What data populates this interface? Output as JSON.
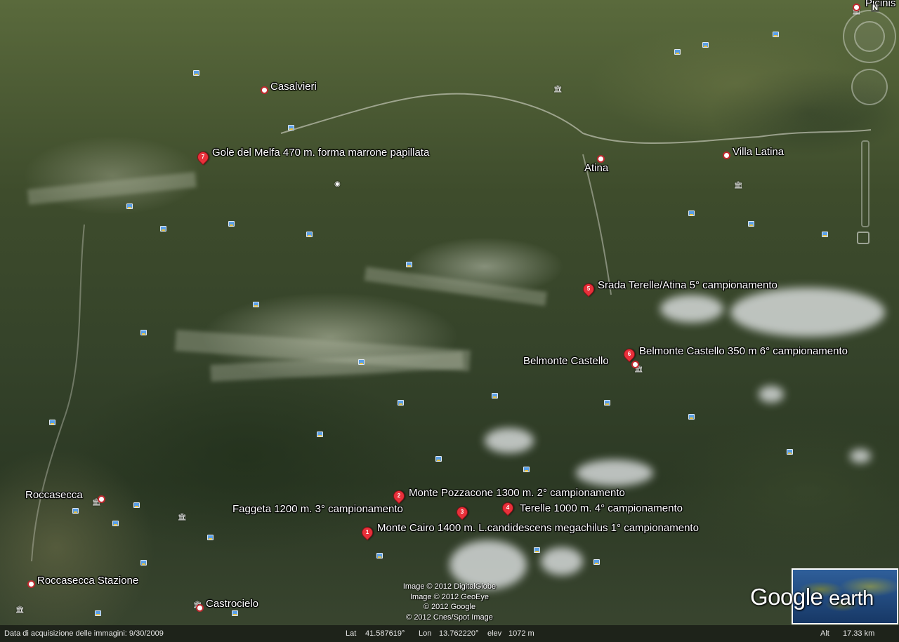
{
  "placemarks": [
    {
      "number": "1",
      "label": "Monte Cairo 1400 m. L.candidescens megachilus 1° campionamento"
    },
    {
      "number": "2",
      "label": "Monte Pozzacone 1300 m. 2° campionamento"
    },
    {
      "number": "3",
      "label": "Faggeta 1200 m. 3° campionamento"
    },
    {
      "number": "4",
      "label": "Terelle 1000 m. 4° campionamento"
    },
    {
      "number": "5",
      "label": "Srada Terelle/Atina 5° campionamento"
    },
    {
      "number": "6",
      "label": "Belmonte Castello 350 m 6° campionamento"
    },
    {
      "number": "7",
      "label": "Gole del Melfa 470 m. forma marrone papillata"
    }
  ],
  "places": {
    "picinisco": "Picinis",
    "casalvieri": "Casalvieri",
    "atina": "Atina",
    "villa_latina": "Villa Latina",
    "belmonte_castello": "Belmonte Castello",
    "roccasecca": "Roccasecca",
    "roccasecca_stazione": "Roccasecca Stazione",
    "castrocielo": "Castrocielo"
  },
  "navigation": {
    "north": "N"
  },
  "copyright": [
    "Image © 2012 DigitalGlobe",
    "Image © 2012 GeoEye",
    "© 2012 Google",
    "© 2012 Cnes/Spot Image"
  ],
  "logo": {
    "google": "Google",
    "earth": "earth"
  },
  "status_bar": {
    "acquisition": "Data di acquisizione delle immagini: 9/30/2009",
    "lat_label": "Lat",
    "lat": "41.587619°",
    "lon_label": "Lon",
    "lon": "13.762220°",
    "elev_label": "elev",
    "elev": "1072 m",
    "alt_label": "Alt",
    "alt": "17.33 km"
  },
  "colors": {
    "pin": "#e8303a",
    "poi": "#5aa0e8"
  }
}
